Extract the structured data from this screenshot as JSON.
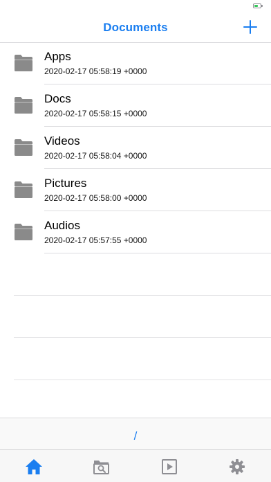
{
  "header": {
    "title": "Documents",
    "add_icon": "plus-icon"
  },
  "files": [
    {
      "name": "Apps",
      "date": "2020-02-17 05:58:19 +0000",
      "icon": "folder-icon"
    },
    {
      "name": "Docs",
      "date": "2020-02-17 05:58:15 +0000",
      "icon": "folder-icon"
    },
    {
      "name": "Videos",
      "date": "2020-02-17 05:58:04 +0000",
      "icon": "folder-icon"
    },
    {
      "name": "Pictures",
      "date": "2020-02-17 05:58:00 +0000",
      "icon": "folder-icon"
    },
    {
      "name": "Audios",
      "date": "2020-02-17 05:57:55 +0000",
      "icon": "folder-icon"
    }
  ],
  "path": {
    "current": "/"
  },
  "tabs": [
    {
      "id": "home",
      "icon": "home-icon",
      "active": true
    },
    {
      "id": "browse",
      "icon": "folder-search-icon",
      "active": false
    },
    {
      "id": "player",
      "icon": "play-icon",
      "active": false
    },
    {
      "id": "settings",
      "icon": "gear-icon",
      "active": false
    }
  ],
  "colors": {
    "accent": "#1a7ef0",
    "folder": "#8a8a8a",
    "tab_inactive": "#8e8e93",
    "battery": "#34c759"
  }
}
